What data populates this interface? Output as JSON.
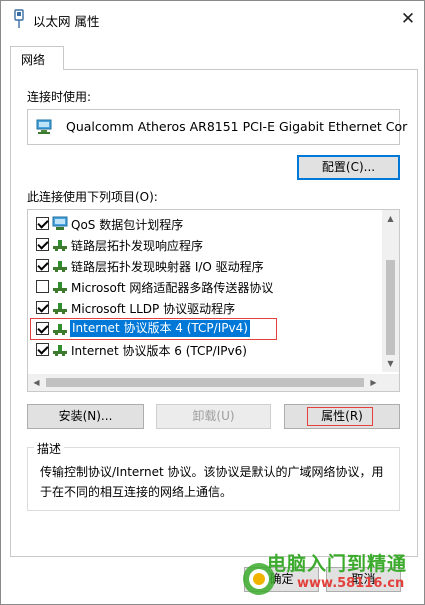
{
  "window": {
    "title": "以太网 属性",
    "close_glyph": "✕"
  },
  "tabs": [
    {
      "label": "网络"
    }
  ],
  "connect_using": {
    "label": "连接时使用:",
    "adapter": "Qualcomm Atheros AR8151 PCI-E Gigabit Ethernet Cor",
    "configure_button": "配置(C)..."
  },
  "items_section": {
    "label": "此连接使用下列项目(O):",
    "items": [
      {
        "label": "QoS 数据包计划程序",
        "checked": true,
        "icon": "qos-scheduler-icon"
      },
      {
        "label": "链路层拓扑发现响应程序",
        "checked": true,
        "icon": "protocol-icon"
      },
      {
        "label": "链路层拓扑发现映射器 I/O 驱动程序",
        "checked": true,
        "icon": "protocol-icon"
      },
      {
        "label": "Microsoft 网络适配器多路传送器协议",
        "checked": false,
        "icon": "protocol-icon"
      },
      {
        "label": "Microsoft LLDP 协议驱动程序",
        "checked": true,
        "icon": "protocol-icon"
      },
      {
        "label": "Internet 协议版本 4 (TCP/IPv4)",
        "checked": true,
        "icon": "protocol-icon",
        "selected": true
      },
      {
        "label": "Internet 协议版本 6 (TCP/IPv6)",
        "checked": true,
        "icon": "protocol-icon"
      }
    ]
  },
  "actions": {
    "install": "安装(N)...",
    "uninstall": "卸载(U)",
    "properties": "属性(R)"
  },
  "description": {
    "legend": "描述",
    "text": "传输控制协议/Internet 协议。该协议是默认的广域网络协议，用于在不同的相互连接的网络上通信。"
  },
  "footer": {
    "ok": "确定",
    "cancel": "取消"
  },
  "watermark": {
    "title": "电脑入门到精通",
    "url": "www.58116.cn"
  },
  "colors": {
    "selection": "#0078d7",
    "highlight_box": "#e2413c",
    "accent_green": "#3cab2d"
  }
}
